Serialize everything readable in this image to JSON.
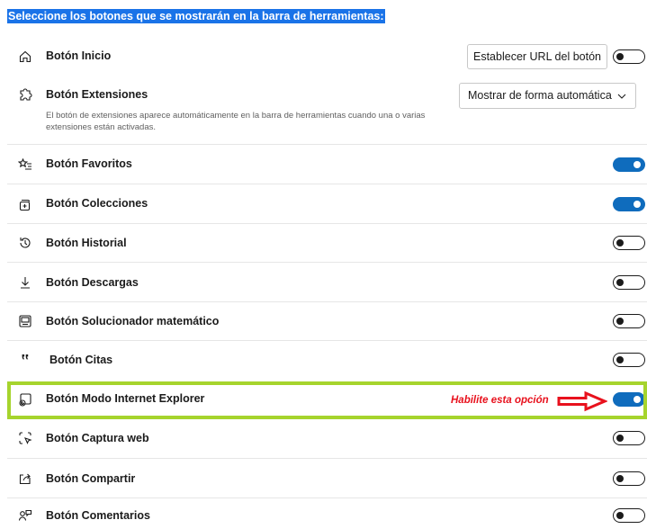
{
  "header": {
    "title": "Seleccione los botones que se mostrarán en la barra de herramientas:"
  },
  "rows": {
    "inicio": {
      "label": "Botón Inicio",
      "icon": "home-icon",
      "state": "off",
      "button_label": "Establecer URL del botón"
    },
    "extensiones": {
      "label": "Botón Extensiones",
      "icon": "puzzle-icon",
      "description": "El botón de extensiones aparece automáticamente en la barra de herramientas cuando una o varias extensiones están activadas.",
      "select_value": "Mostrar de forma automática"
    },
    "favoritos": {
      "label": "Botón Favoritos",
      "icon": "star-list-icon",
      "state": "on"
    },
    "colecciones": {
      "label": "Botón Colecciones",
      "icon": "collections-icon",
      "state": "on"
    },
    "historial": {
      "label": "Botón Historial",
      "icon": "history-icon",
      "state": "off"
    },
    "descargas": {
      "label": "Botón Descargas",
      "icon": "download-icon",
      "state": "off"
    },
    "solucionador": {
      "label": "Botón Solucionador matemático",
      "icon": "math-solver-icon",
      "state": "off"
    },
    "citas": {
      "label": "Botón Citas",
      "icon": "quote-icon",
      "state": "off"
    },
    "ie_mode": {
      "label": "Botón Modo Internet Explorer",
      "icon": "ie-mode-icon",
      "state": "on"
    },
    "captura": {
      "label": "Botón Captura web",
      "icon": "web-capture-icon",
      "state": "off"
    },
    "compartir": {
      "label": "Botón Compartir",
      "icon": "share-icon",
      "state": "off"
    },
    "comentarios": {
      "label": "Botón Comentarios",
      "icon": "feedback-icon",
      "state": "off"
    }
  },
  "annotation": {
    "text": "Habilite esta opción",
    "color": "#e8111d"
  },
  "colors": {
    "toggle_on": "#0f6cbd",
    "highlight_border": "#a6d42d",
    "header_bg": "#1a73e8"
  }
}
